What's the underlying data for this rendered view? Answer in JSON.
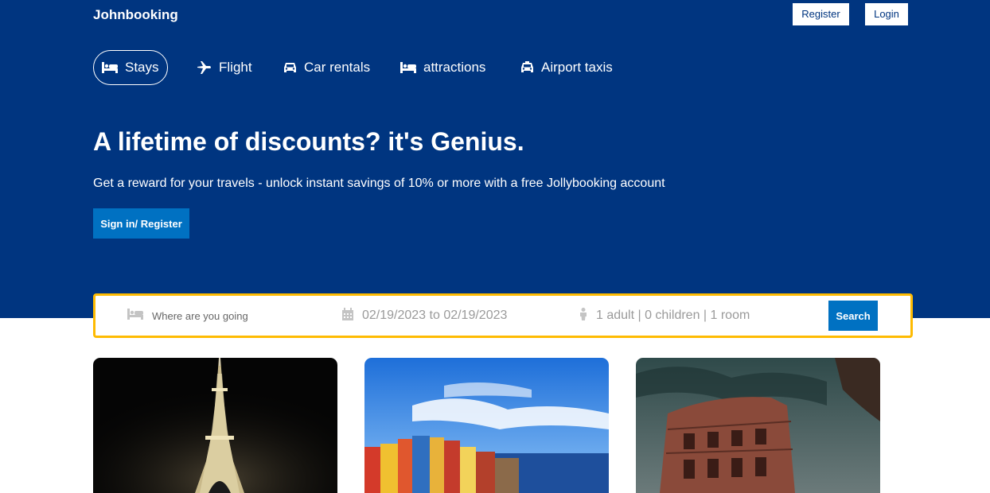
{
  "header": {
    "logo": "Johnbooking",
    "register_label": "Register",
    "login_label": "Login",
    "background_color": "#003580"
  },
  "nav": {
    "items": [
      {
        "label": "Stays",
        "icon": "bed-icon",
        "active": true
      },
      {
        "label": "Flight",
        "icon": "plane-icon",
        "active": false
      },
      {
        "label": "Car rentals",
        "icon": "car-icon",
        "active": false
      },
      {
        "label": "attractions",
        "icon": "bed-icon",
        "active": false
      },
      {
        "label": "Airport taxis",
        "icon": "taxi-icon",
        "active": false
      }
    ]
  },
  "hero": {
    "title": "A lifetime of discounts? it's Genius.",
    "subtitle": "Get a reward for your travels - unlock instant savings of 10% or more with a free Jollybooking account",
    "signin_label": "Sign in/ Register"
  },
  "search": {
    "destination_placeholder": "Where are you going",
    "dates": "02/19/2023 to 02/19/2023",
    "occupancy": "1 adult | 0 children | 1 room",
    "search_label": "Search",
    "border_color": "#febb02",
    "button_color": "#0071c2"
  },
  "cards": [
    {
      "image": "eiffel-tower-night"
    },
    {
      "image": "colorful-coastal-village"
    },
    {
      "image": "colosseum-stormy-sky"
    }
  ]
}
